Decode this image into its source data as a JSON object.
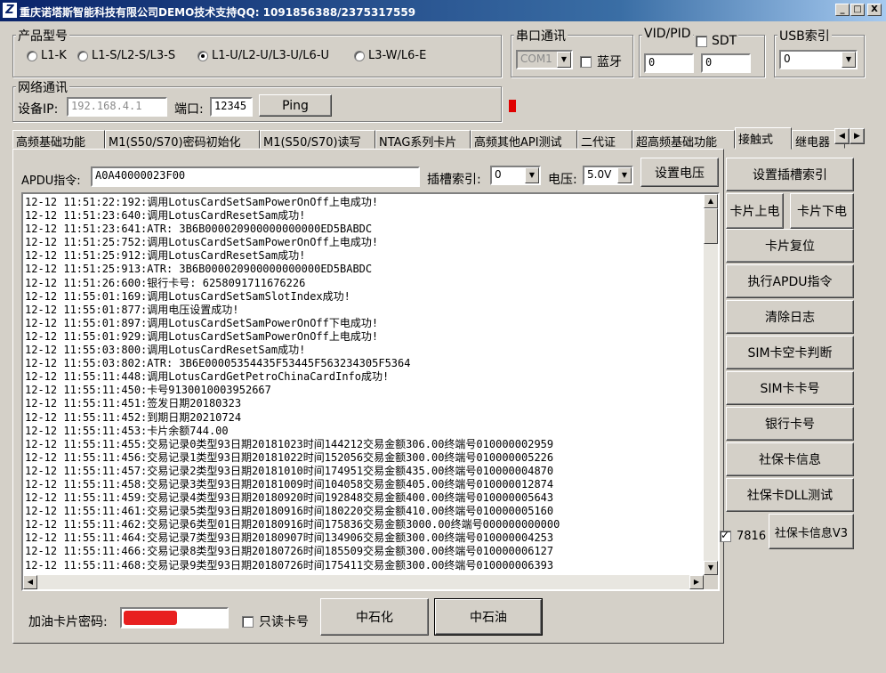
{
  "window": {
    "title": "重庆诺塔斯智能科技有限公司DEMO技术支持QQ: 1091856388/2375317559",
    "minimize": "_",
    "maximize": "□",
    "close": "X"
  },
  "product": {
    "label": "产品型号",
    "options": [
      "L1-K",
      "L1-S/L2-S/L3-S",
      "L1-U/L2-U/L3-U/L6-U",
      "L3-W/L6-E"
    ],
    "selected_index": 2
  },
  "serial": {
    "label": "串口通讯",
    "port": "COM1",
    "bluetooth_label": "蓝牙",
    "bluetooth_checked": false
  },
  "vidpid": {
    "label": "VID/PID",
    "sdt_label": "SDT",
    "sdt_checked": false,
    "vid": "0",
    "pid": "0"
  },
  "usb": {
    "label": "USB索引",
    "value": "0"
  },
  "network": {
    "label": "网络通讯",
    "ip_label": "设备IP:",
    "ip_value": "192.168.4.1",
    "port_label": "端口:",
    "port_value": "12345",
    "ping_label": "Ping"
  },
  "status_color": "#e00000",
  "tabs": [
    "高频基础功能",
    "M1(S50/S70)密码初始化",
    "M1(S50/S70)读写",
    "NTAG系列卡片",
    "高频其他API测试",
    "二代证",
    "超高频基础功能",
    "接触式",
    "继电器"
  ],
  "active_tab": 7,
  "apdu": {
    "label": "APDU指令:",
    "value": "A0A40000023F00",
    "slot_label": "插槽索引:",
    "slot_value": "0",
    "voltage_label": "电压:",
    "voltage_value": "5.0V",
    "set_voltage_label": "设置电压"
  },
  "side_buttons": {
    "set_slot": "设置插槽索引",
    "power_on": "卡片上电",
    "power_off": "卡片下电",
    "reset": "卡片复位",
    "exec_apdu": "执行APDU指令",
    "clear_log": "清除日志",
    "sim_empty": "SIM卡空卡判断",
    "sim_no": "SIM卡卡号",
    "bank_no": "银行卡号",
    "social_info": "社保卡信息",
    "social_dll": "社保卡DLL测试",
    "social_v3": "社保卡信息V3",
    "chk_7816_label": "7816",
    "chk_7816_checked": true
  },
  "log": [
    "12-12 11:51:22:192:调用LotusCardSetSamPowerOnOff上电成功!",
    "12-12 11:51:23:640:调用LotusCardResetSam成功!",
    "12-12 11:51:23:641:ATR: 3B6B000020900000000000ED5BABDC",
    "12-12 11:51:25:752:调用LotusCardSetSamPowerOnOff上电成功!",
    "12-12 11:51:25:912:调用LotusCardResetSam成功!",
    "12-12 11:51:25:913:ATR: 3B6B000020900000000000ED5BABDC",
    "12-12 11:51:26:600:银行卡号: 6258091711676226",
    "12-12 11:55:01:169:调用LotusCardSetSamSlotIndex成功!",
    "12-12 11:55:01:877:调用电压设置成功!",
    "12-12 11:55:01:897:调用LotusCardSetSamPowerOnOff下电成功!",
    "12-12 11:55:01:929:调用LotusCardSetSamPowerOnOff上电成功!",
    "12-12 11:55:03:800:调用LotusCardResetSam成功!",
    "12-12 11:55:03:802:ATR: 3B6E00005354435F53445F563234305F5364",
    "12-12 11:55:11:448:调用LotusCardGetPetroChinaCardInfo成功!",
    "12-12 11:55:11:450:卡号9130010003952667",
    "12-12 11:55:11:451:签发日期20180323",
    "12-12 11:55:11:452:到期日期20210724",
    "12-12 11:55:11:453:卡片余额744.00",
    "12-12 11:55:11:455:交易记录0类型93日期20181023时间144212交易金额306.00终端号010000002959",
    "12-12 11:55:11:456:交易记录1类型93日期20181022时间152056交易金额300.00终端号010000005226",
    "12-12 11:55:11:457:交易记录2类型93日期20181010时间174951交易金额435.00终端号010000004870",
    "12-12 11:55:11:458:交易记录3类型93日期20181009时间104058交易金额405.00终端号010000012874",
    "12-12 11:55:11:459:交易记录4类型93日期20180920时间192848交易金额400.00终端号010000005643",
    "12-12 11:55:11:461:交易记录5类型93日期20180916时间180220交易金额410.00终端号010000005160",
    "12-12 11:55:11:462:交易记录6类型01日期20180916时间175836交易金额3000.00终端号000000000000",
    "12-12 11:55:11:464:交易记录7类型93日期20180907时间134906交易金额300.00终端号010000004253",
    "12-12 11:55:11:466:交易记录8类型93日期20180726时间185509交易金额300.00终端号010000006127",
    "12-12 11:55:11:468:交易记录9类型93日期20180726时间175411交易金额300.00终端号010000006393"
  ],
  "fuel": {
    "password_label": "加油卡片密码:",
    "read_only_label": "只读卡号",
    "read_only_checked": false,
    "sinopec_label": "中石化",
    "petrochina_label": "中石油"
  }
}
